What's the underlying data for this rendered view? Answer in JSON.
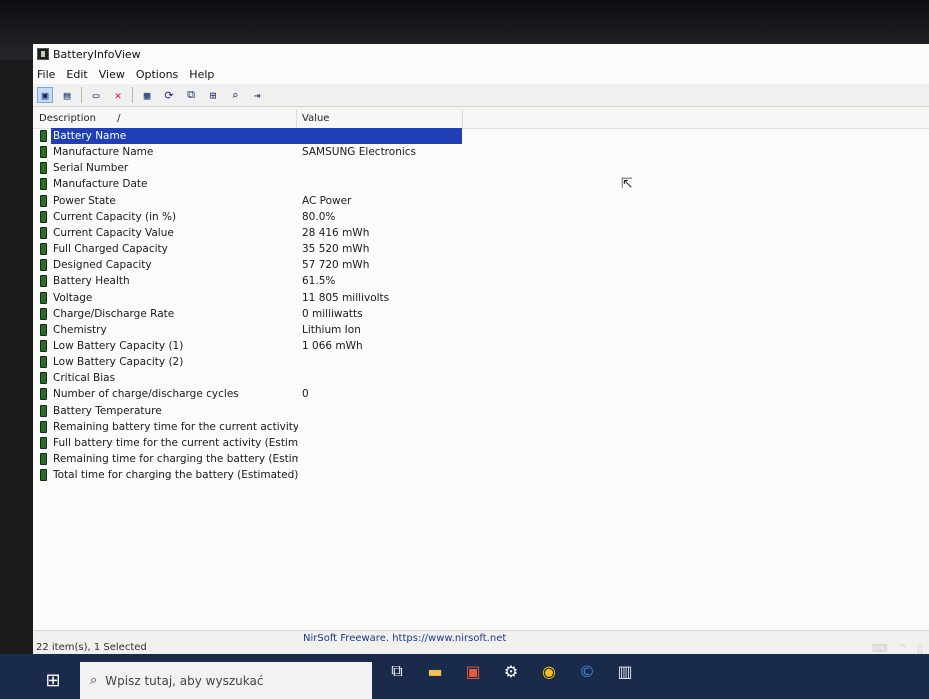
{
  "window": {
    "title": "BatteryInfoView",
    "menu": [
      "File",
      "Edit",
      "View",
      "Options",
      "Help"
    ]
  },
  "toolbar": {
    "buttons": [
      {
        "name": "view-mode-icon",
        "glyph": "▣"
      },
      {
        "name": "copy-icon",
        "glyph": "▤"
      },
      {
        "name": "report-icon",
        "glyph": "▭"
      },
      {
        "name": "delete-icon",
        "glyph": "✕"
      },
      {
        "name": "save-icon",
        "glyph": "▦"
      },
      {
        "name": "refresh-icon",
        "glyph": "⟳"
      },
      {
        "name": "copy-items-icon",
        "glyph": "⧉"
      },
      {
        "name": "properties-icon",
        "glyph": "⊞"
      },
      {
        "name": "find-icon",
        "glyph": "⌕"
      },
      {
        "name": "exit-icon",
        "glyph": "⇥"
      }
    ]
  },
  "columns": {
    "description": "Description",
    "sort_indicator": "/",
    "value": "Value"
  },
  "rows": [
    {
      "description": "Battery Name",
      "value": "",
      "selected": true
    },
    {
      "description": "Manufacture Name",
      "value": "SAMSUNG Electronics"
    },
    {
      "description": "Serial Number",
      "value": ""
    },
    {
      "description": "Manufacture Date",
      "value": ""
    },
    {
      "description": "Power State",
      "value": "AC Power"
    },
    {
      "description": "Current Capacity (in %)",
      "value": "80.0%"
    },
    {
      "description": "Current Capacity Value",
      "value": "28 416 mWh"
    },
    {
      "description": "Full Charged Capacity",
      "value": "35 520 mWh"
    },
    {
      "description": "Designed Capacity",
      "value": "57 720 mWh"
    },
    {
      "description": "Battery Health",
      "value": "61.5%"
    },
    {
      "description": "Voltage",
      "value": "11 805 millivolts"
    },
    {
      "description": "Charge/Discharge Rate",
      "value": "0 milliwatts"
    },
    {
      "description": "Chemistry",
      "value": "Lithium Ion"
    },
    {
      "description": "Low Battery Capacity (1)",
      "value": "1 066 mWh"
    },
    {
      "description": "Low Battery Capacity (2)",
      "value": ""
    },
    {
      "description": "Critical Bias",
      "value": ""
    },
    {
      "description": "Number of charge/discharge cycles",
      "value": "0"
    },
    {
      "description": "Battery Temperature",
      "value": ""
    },
    {
      "description": "Remaining battery time for the current activity (Est...",
      "value": ""
    },
    {
      "description": "Full battery time for the current activity (Estimated)",
      "value": ""
    },
    {
      "description": "Remaining time for charging the battery (Estimated)",
      "value": ""
    },
    {
      "description": "Total  time for charging the battery (Estimated)",
      "value": ""
    }
  ],
  "status": {
    "count": "22 item(s), 1 Selected",
    "credit": "NirSoft Freeware. https://www.nirsoft.net"
  },
  "taskbar": {
    "search_placeholder": "Wpisz tutaj, aby wyszukać",
    "apps": [
      {
        "name": "task-view-icon",
        "glyph": "⧉"
      },
      {
        "name": "file-explorer-icon",
        "glyph": "▬"
      },
      {
        "name": "store-icon",
        "glyph": "▣"
      },
      {
        "name": "settings-icon",
        "glyph": "⚙"
      },
      {
        "name": "chrome-icon",
        "glyph": "◉"
      },
      {
        "name": "ccleaner-icon",
        "glyph": "©"
      },
      {
        "name": "batteryinfoview-icon",
        "glyph": "▥"
      }
    ]
  },
  "colors": {
    "selection": "#1e3fb6",
    "battery_icon": "#2d6b2a",
    "taskbar": "#1a2a4a"
  }
}
